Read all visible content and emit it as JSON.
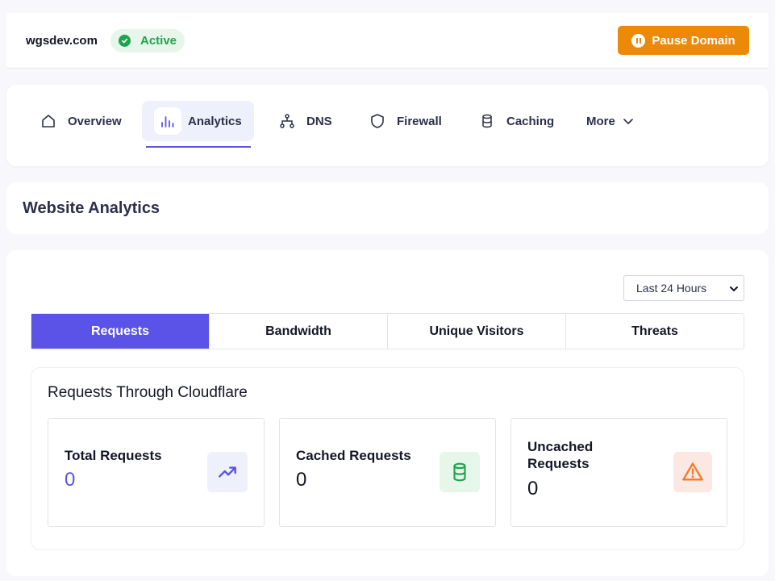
{
  "header": {
    "domain": "wgsdev.com",
    "status_label": "Active",
    "pause_label": "Pause Domain"
  },
  "nav": {
    "items": [
      {
        "label": "Overview",
        "icon": "home-icon"
      },
      {
        "label": "Analytics",
        "icon": "bar-chart-icon",
        "active": true
      },
      {
        "label": "DNS",
        "icon": "network-icon"
      },
      {
        "label": "Firewall",
        "icon": "shield-icon"
      },
      {
        "label": "Caching",
        "icon": "database-icon"
      },
      {
        "label": "More",
        "icon": "chevron-down-icon"
      }
    ]
  },
  "page": {
    "title": "Website Analytics"
  },
  "filter": {
    "selected": "Last 24 Hours"
  },
  "tabs": [
    "Requests",
    "Bandwidth",
    "Unique Visitors",
    "Threats"
  ],
  "stats": {
    "heading": "Requests Through Cloudflare",
    "total": {
      "label": "Total Requests",
      "value": "0"
    },
    "cached": {
      "label": "Cached Requests",
      "value": "0"
    },
    "uncached": {
      "label": "Uncached Requests",
      "value": "0"
    }
  },
  "colors": {
    "accent": "#5b52e8",
    "active_green": "#1ea44d",
    "pause_orange": "#ec8a08",
    "cached_green": "#1ea44d",
    "uncached_orange": "#f07a2c"
  }
}
